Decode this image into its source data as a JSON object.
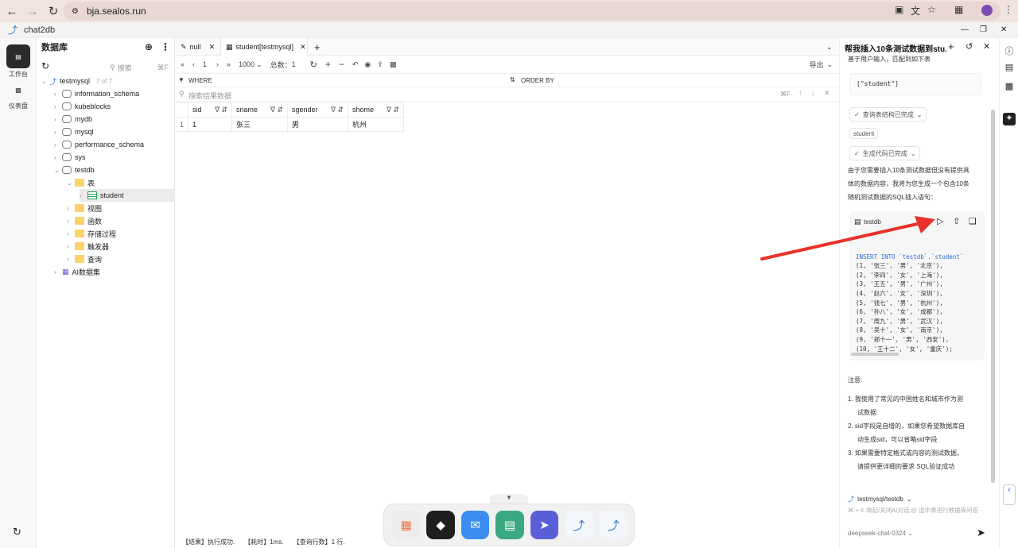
{
  "browser": {
    "url": "bja.sealos.run",
    "app_title": "chat2db"
  },
  "rail": {
    "items": [
      {
        "label": "工作台"
      },
      {
        "label": "仪表盘"
      }
    ]
  },
  "tree": {
    "title": "数据库",
    "search_placeholder": "搜索",
    "search_shortcut": "⌘F",
    "connection": {
      "name": "testmysql",
      "count": "7 of 7"
    },
    "databases": [
      "information_schema",
      "kubeblocks",
      "mydb",
      "mysql",
      "performance_schema",
      "sys",
      "testdb"
    ],
    "testdb_children": {
      "tables_folder": "表",
      "table": "student",
      "folders": [
        "视图",
        "函数",
        "存储过程",
        "触发器",
        "查询"
      ]
    },
    "ai_dataset": "AI数据集"
  },
  "tabs": [
    {
      "label": "null"
    },
    {
      "label": "student[testmysql]"
    }
  ],
  "toolbar": {
    "page": "1",
    "page_size": "1000",
    "total_label": "总数：",
    "total": "1",
    "export": "导出"
  },
  "filter": {
    "where": "WHERE",
    "order_by": "ORDER BY"
  },
  "result_search": {
    "placeholder": "搜索结果数据",
    "shortcut": "⌘F"
  },
  "grid": {
    "columns": [
      "sid",
      "sname",
      "sgender",
      "shome"
    ],
    "rows": [
      {
        "index": "1",
        "cells": [
          "1",
          "张三",
          "男",
          "杭州"
        ]
      }
    ]
  },
  "status": {
    "result": "【结果】执行成功.",
    "time": "【耗时】1ms.",
    "rows": "【查询行数】1 行."
  },
  "ai": {
    "title": "帮我插入10条测试数据到stu...",
    "intro": "基于用户输入，匹配到如下表",
    "matched_tables": "[\"student\"]",
    "step1": "查询表结构已完成",
    "table_tag": "student",
    "step2": "生成代码已完成",
    "explanation_lines": [
      "由于您需要插入10条测试数据但没有提供具",
      "体的数据内容，我将为您生成一个包含10条",
      "随机测试数据的SQL插入语句："
    ],
    "code_db": "testdb",
    "code_lines": [
      "INSERT INTO `testdb`.`student`",
      "(1, '张三', '男', '北京'),",
      "(2, '李四', '女', '上海'),",
      "(3, '王五', '男', '广州'),",
      "(4, '赵六', '女', '深圳'),",
      "(5, '钱七', '男', '杭州'),",
      "(6, '孙八', '女', '成都'),",
      "(7, '周九', '男', '武汉'),",
      "(8, '吴十', '女', '南京'),",
      "(9, '郑十一', '男', '西安'),",
      "(10, '王十二', '女', '重庆');"
    ],
    "notes_title": "注意:",
    "notes": [
      {
        "n": "1.",
        "lines": [
          "我使用了常见的中国姓名和城市作为测",
          "试数据"
        ]
      },
      {
        "n": "2.",
        "lines": [
          "sid字段是自增的，如果您希望数据库自",
          "动生成sid，可以省略sid字段"
        ]
      },
      {
        "n": "3.",
        "lines": [
          "如果需要特定格式或内容的测试数据，",
          "请提供更详细的要求 SQL验证成功"
        ]
      }
    ],
    "composer_context": "testmysql/testdb",
    "composer_placeholder": "⌘ + K 唤起/关闭AI对话,@ 选中表进行数据库问答",
    "model": "deepseek-chat-0324"
  },
  "colors": {
    "accent": "#2a6fd6",
    "selected": "#ebebeb",
    "arrow": "#e8322a"
  }
}
